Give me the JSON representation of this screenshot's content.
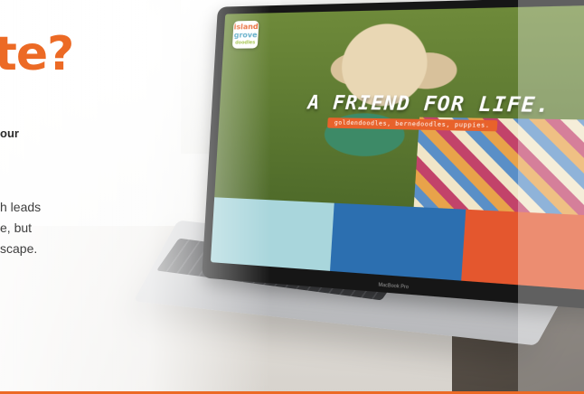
{
  "copy": {
    "headline": "te?",
    "subhead": "our",
    "lines": [
      "h leads",
      "e, but",
      "scape."
    ]
  },
  "laptop": {
    "model_label": "MacBook Pro",
    "site": {
      "logo_line1": "island",
      "logo_line2": "grove",
      "logo_line3": "doodles",
      "hero_title": "A FRIEND FOR LIFE.",
      "hero_subtitle": "goldendoodles, bernedoodles, puppies.",
      "menu_icon": "hamburger-menu-icon"
    }
  },
  "colors": {
    "accent": "#ec6a25",
    "tile_light_blue": "#a9d6dc",
    "tile_blue": "#2c6fb0",
    "tile_orange": "#e4572e"
  }
}
